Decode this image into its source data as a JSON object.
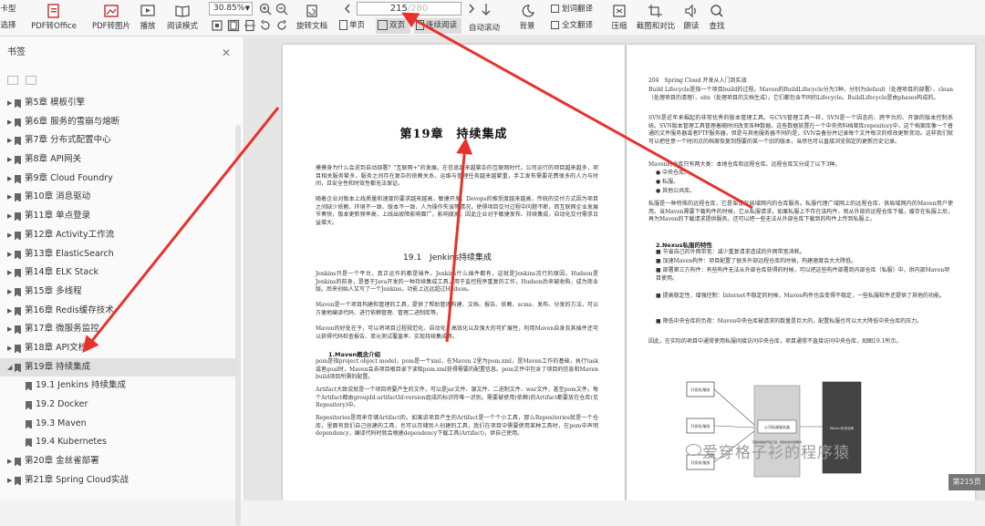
{
  "toolbar": {
    "left_cut_label_top": "卡型",
    "left_cut_label_bottom": "选择",
    "pdf_to_office": "PDF转Office",
    "pdf_to_image": "PDF转图片",
    "play": "播放",
    "read_mode": "阅读模式",
    "zoom": "30.85%",
    "rotate": "旋转文档",
    "single_page": "单页",
    "double_page": "双页",
    "continuous": "连续阅读",
    "page_current": "215",
    "page_total": "/280",
    "auto_scroll": "自动滚动",
    "background": "背景",
    "word_translate": "划词翻译",
    "full_translate": "全文翻译",
    "compress": "压缩",
    "screenshot_compare": "截图和对比",
    "read_aloud": "朗读",
    "find": "查找"
  },
  "sidebar": {
    "title": "书签",
    "items": [
      {
        "label": "第5章 模板引擎",
        "level": 0,
        "expanded": false
      },
      {
        "label": "第6章 服务的雪崩与熔断",
        "level": 0,
        "expanded": false
      },
      {
        "label": "第7章 分布式配置中心",
        "level": 0,
        "expanded": false
      },
      {
        "label": "第8章 API网关",
        "level": 0,
        "expanded": false
      },
      {
        "label": "第9章 Cloud Foundry",
        "level": 0,
        "expanded": false
      },
      {
        "label": "第10章 消息驱动",
        "level": 0,
        "expanded": false
      },
      {
        "label": "第11章 单点登录",
        "level": 0,
        "expanded": false
      },
      {
        "label": "第12章 Activity工作流",
        "level": 0,
        "expanded": false
      },
      {
        "label": "第13章 ElasticSearch",
        "level": 0,
        "expanded": false
      },
      {
        "label": "第14章 ELK Stack",
        "level": 0,
        "expanded": false
      },
      {
        "label": "第15章 多线程",
        "level": 0,
        "expanded": false
      },
      {
        "label": "第16章 Redis缓存技术",
        "level": 0,
        "expanded": false
      },
      {
        "label": "第17章 微服务监控",
        "level": 0,
        "expanded": false
      },
      {
        "label": "第18章 API文档",
        "level": 0,
        "expanded": false
      },
      {
        "label": "第19章 持续集成",
        "level": 0,
        "expanded": true
      },
      {
        "label": "19.1 Jenkins 持续集成",
        "level": 1
      },
      {
        "label": "19.2 Docker",
        "level": 1
      },
      {
        "label": "19.3 Maven",
        "level": 1
      },
      {
        "label": "19.4 Kubernetes",
        "level": 1
      },
      {
        "label": "第20章 金丝雀部署",
        "level": 0,
        "expanded": false
      },
      {
        "label": "第21章 Spring Cloud实战",
        "level": 0,
        "expanded": false
      }
    ]
  },
  "left_page": {
    "chapter_title": "第19章　持续集成",
    "intro_1": "摸摸身为什么会说到自动部署？\"互联网+\"的发展。在信息越来越繁杂的互联网时代，公司运行的项目越来越多，项目相关服务繁多，服务之间存在复杂的依赖关系，运维与管理任务越来越繁重，手工发布需要花费很多的人力与时间，且安全性和时效性都无法保证。",
    "intro_2": "随着企业对版本上线质量和速度的要求越来越高，敏捷开发、Devops的推受度越来越高，传统的交付方式因为项目之间缺少依赖、环境不一致、版本不一致、人为操作失误等情况，使得项目交付过程中问题不断，而互联网企业发展节奏快，版本更新频率高，上线出故障影响面广，影响度高，因此企业对于敏捷发布、持续集成，自动化交付需求日益增大。",
    "section_title": "19.1　Jenkins持续集成",
    "p1": "Jenkins只是一个平台，真正运作的都是插件。Jenkins什么插件都有，这就是Jenkins流行的原因。Hudson是Jenkins的前身，是基于Java开发的一种持续集成工具，用于监控程序重复的工作，Hudson后来被收购，成为商业版。后来创始人又写了一个Jenkins，功能上远远超过Hudson。",
    "p2": "Maven是一个项目构建和管理的工具，提供了帮助管理构建、文档、报告、依赖、scms、发布、分发的方法，可以方便地编译代码、进行依赖管理、管理二进制库等。",
    "p3": "Maven的好处在于，可以将项目过程规范化、自动化、高效化以及强大的可扩展性，利用Maven自身及其插件还可以获得代码检查报告、单元测试覆盖率、实现持续集成等。",
    "sub1": "1.Maven概念介绍",
    "p4": "pom是指project object model，pom是一个xml，在Maven 2里为pom.xml，是Maven工作的基础，执行task或者goal时，Maven会去项目根目录下读取pom.xml获得需要的配置信息。pom文件中包含了项目的信息和Maven build项目所需的配置。",
    "p5": "Artifact大致说就是一个项目将要产生的文件，可以是jar文件、源文件、二进制文件、war文件，甚至pom文件。每个Artifact都由groupId:artifactId:version组成的标识符唯一识别。需要被使用(依赖)的Artifact都要放在仓库(见Repository)中。",
    "p6": "Repositories是用来存储Artifact的。如果说项目产生的Artifact是一个个小工具，那么Repositories就是一个仓库，里面有我们自己创建的工具，也可以存储别人创建的工具，我们在项目中需要使用某种工具时，在pom中声明dependency，编译代码时就会根据dependency下载工具(Artifact)，供自己使用。"
  },
  "right_page": {
    "header": "204　Spring Cloud 开发从入门到实战",
    "p1": "Build Lifecycle是指一个项目build的过程。Maven的BuildLifecycle分为3种，分别为default（处理项目的部署）、clean（处理项目的清理）、site（处理项目的文档生成）。它们都包含不同的Lifecycle。BuildLifecycle是由phases构成的。",
    "p2": "SVN是近年来崛起的非常优秀的版本管理工具。与CVS管理工具一样，SVN是一个因态的、跨平台的、开源的版本控制系统。SVN版本管理工具管理着随时间改变各种数据。这些数据放置在一个中央资料档案库repository中，这个档案库像一个普通的文件服务器或者FTP服务器，但是与其他服务器不同的是，SVN会备份并记录每个文件每次的修改更新变动。这样我们就可以把任意一个时间点的档案恢复到想要的某一个旧的版本，当然也可以直接浏览指定的更新历史记录。",
    "p3": "Maven的仓库只有两大类：本地仓库和远程仓库。远程仓库又分成了以下3种。",
    "bullets": [
      "中央仓库。",
      "私服。",
      "其他公共库。"
    ],
    "p4": "私服是一种特殊的远程仓库，它是架设在局域网内的仓库服务。私服代理广域网上的远程仓库，供局域网内的Maven用户使用。当Maven需要下载构件的时候，它从私服请求，如果私服上不存在该构件，则从外部的远程仓库下载，缓存在私服上后，再为Maven的下载请求提供服务。还可以把一些无法从外部仓库下载到的构件上传到私服上。",
    "sub": "2.Nexus私服的特性",
    "features": [
      "节省自己的外网带宽：减少重复请求造成的外网带宽消耗。",
      "加速Maven构件：项目配置了很多外部远程仓库的时候，构建速度会大大降低。",
      "部署第三方构件：有些构件无法从外部仓库获得的时候，可以把这些构件部署到内部仓库（私服）中，供内部Maven项目使用。",
      "提高稳定性、增强控制：Internet不稳定的时候，Maven构件也会变得不稳定，一些私服软件还提供了其他的功能。",
      "降低中央仓库的负荷：Maven中央仓库被请求的数量是巨大的，配置私服也可以大大降低中央仓库的压力。"
    ],
    "p5": "因此，在实际的项目中通常使用私服间接访问中央仓库，项目通常不直接访问中央仓库，如图19.1所示。",
    "diagram": {
      "client_label": "开发机/服务",
      "nexus_label": "公司私服服务器",
      "nexus_sub": "营提供各类开发工具、持续化的仓库服务",
      "central_label": "Maven中央仓库"
    }
  },
  "watermark": "爱穿格子衫的程序猿",
  "page_badge": "第215页"
}
